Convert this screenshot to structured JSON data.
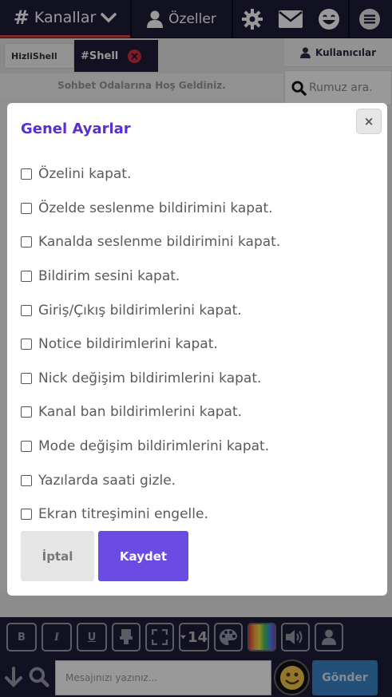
{
  "nav": {
    "channels_label": "Kanallar",
    "private_label": "Özeller",
    "channel_hash": "#"
  },
  "tabs": [
    {
      "label": "HizliShell",
      "active": false
    },
    {
      "label": "#Shell",
      "active": true
    }
  ],
  "chat": {
    "welcome": "Sohbet Odalarına Hoş Geldiniz."
  },
  "users_panel": {
    "title": "Kullanıcılar",
    "search_placeholder": "Rumuz ara."
  },
  "modal": {
    "title": "Genel Ayarlar",
    "close": "×",
    "options": [
      {
        "label": "Özelini kapat.",
        "checked": false
      },
      {
        "label": "Özelde seslenme bildirimini kapat.",
        "checked": false
      },
      {
        "label": "Kanalda seslenme bildirimini kapat.",
        "checked": false
      },
      {
        "label": "Bildirim sesini kapat.",
        "checked": false
      },
      {
        "label": "Giriş/Çıkış bildirimlerini kapat.",
        "checked": false
      },
      {
        "label": "Notice bildirimlerini kapat.",
        "checked": false
      },
      {
        "label": "Nick değişim bildirimlerini kapat.",
        "checked": false
      },
      {
        "label": "Kanal ban bildirimlerini kapat.",
        "checked": false
      },
      {
        "label": "Mode değişim bildirimlerini kapat.",
        "checked": false
      },
      {
        "label": "Yazılarda saati gizle.",
        "checked": false
      },
      {
        "label": "Ekran titreşimini engelle.",
        "checked": false
      }
    ],
    "cancel_label": "İptal",
    "save_label": "Kaydet"
  },
  "toolbar": {
    "bold": "B",
    "italic": "I",
    "underline": "U",
    "font_size": "14"
  },
  "input": {
    "placeholder": "Mesajınızı yazınız...",
    "send_label": "Gönder"
  },
  "colors": {
    "nav_bg": "#1f1d3a",
    "accent": "#6a4be3",
    "title": "#5a2fd0",
    "send": "#3a85c9",
    "close_tab": "#d42e3c"
  }
}
